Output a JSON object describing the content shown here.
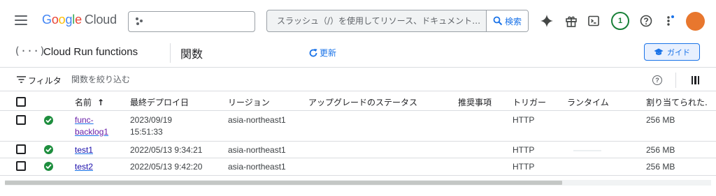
{
  "header": {
    "logo_letters": [
      "G",
      "o",
      "o",
      "g",
      "l",
      "e"
    ],
    "logo_product": "Cloud",
    "search_placeholder": "スラッシュ（/）を使用してリソース、ドキュメント…",
    "search_button": "検索",
    "notification_count": "1",
    "icons": [
      "menu-icon",
      "project-dots-icon",
      "search-icon",
      "gemini-spark-icon",
      "gift-icon",
      "cloud-shell-icon",
      "help-icon",
      "more-vert-icon"
    ],
    "avatar_color": "#e8772e"
  },
  "page": {
    "product": "Cloud Run functions",
    "product_icon_text": "(···)",
    "title": "関数",
    "refresh_label": "更新",
    "guide_label": "ガイド"
  },
  "filter": {
    "label": "フィルタ",
    "placeholder": "関数を絞り込む"
  },
  "table": {
    "columns": [
      "名前",
      "最終デプロイ日",
      "リージョン",
      "アップグレードのステータス",
      "推奨事項",
      "トリガー",
      "ランタイム",
      "割り当てられた."
    ],
    "sort_indicator": "↑",
    "rows": [
      {
        "name_line1": "func-",
        "name_line2": "backlog1",
        "deployed_date": "2023/09/19",
        "deployed_time": "15:51:33",
        "region": "asia-northeast1",
        "trigger": "HTTP",
        "memory": "256 MB"
      },
      {
        "name": "test1",
        "deployed": "2022/05/13 9:34:21",
        "region": "asia-northeast1",
        "trigger": "HTTP",
        "memory": "256 MB"
      },
      {
        "name": "test2",
        "deployed": "2022/05/13 9:42:20",
        "region": "asia-northeast1",
        "trigger": "HTTP",
        "memory": "256 MB"
      }
    ]
  },
  "colors": {
    "accent": "#1a73e8",
    "status_ok": "#1e8e3e",
    "notification_ring": "#188038"
  }
}
